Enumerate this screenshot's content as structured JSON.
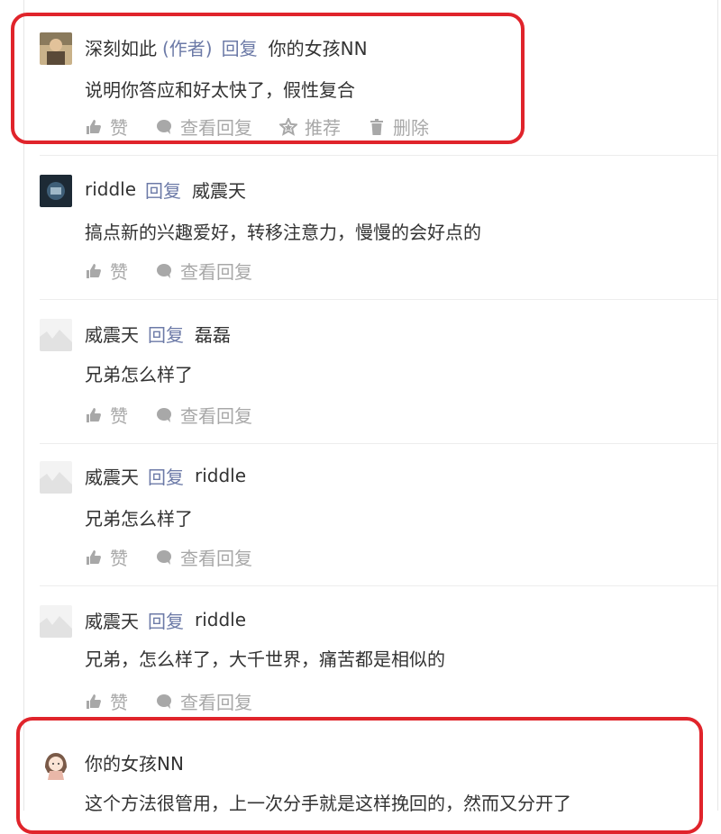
{
  "colors": {
    "highlight": "#e0242b",
    "link": "#6c7aa7",
    "text": "#333333",
    "muted": "#a8a8a8",
    "divider": "#ededed"
  },
  "comments": [
    {
      "username": "深刻如此",
      "tag": "(作者)",
      "reply_label": "回复",
      "target": "你的女孩NN",
      "content": "说明你答应和好太快了，假性复合",
      "actions": [
        "赞",
        "查看回复",
        "推荐",
        "删除"
      ],
      "avatar": "photo-avatar"
    },
    {
      "username": "riddle",
      "reply_label": "回复",
      "target": "威震天",
      "content": "搞点新的兴趣爱好，转移注意力，慢慢的会好点的",
      "actions": [
        "赞",
        "查看回复"
      ],
      "avatar": "dark-avatar"
    },
    {
      "username": "威震天",
      "reply_label": "回复",
      "target": "磊磊",
      "content": "兄弟怎么样了",
      "actions": [
        "赞",
        "查看回复"
      ],
      "avatar": "placeholder-avatar"
    },
    {
      "username": "威震天",
      "reply_label": "回复",
      "target": "riddle",
      "content": "兄弟怎么样了",
      "actions": [
        "赞",
        "查看回复"
      ],
      "avatar": "placeholder-avatar"
    },
    {
      "username": "威震天",
      "reply_label": "回复",
      "target": "riddle",
      "content": "兄弟，怎么样了，大千世界，痛苦都是相似的",
      "actions": [
        "赞",
        "查看回复"
      ],
      "avatar": "placeholder-avatar"
    },
    {
      "username": "你的女孩NN",
      "content": "这个方法很管用，上一次分手就是这样挽回的，然而又分开了",
      "avatar": "cartoon-girl-avatar"
    }
  ]
}
